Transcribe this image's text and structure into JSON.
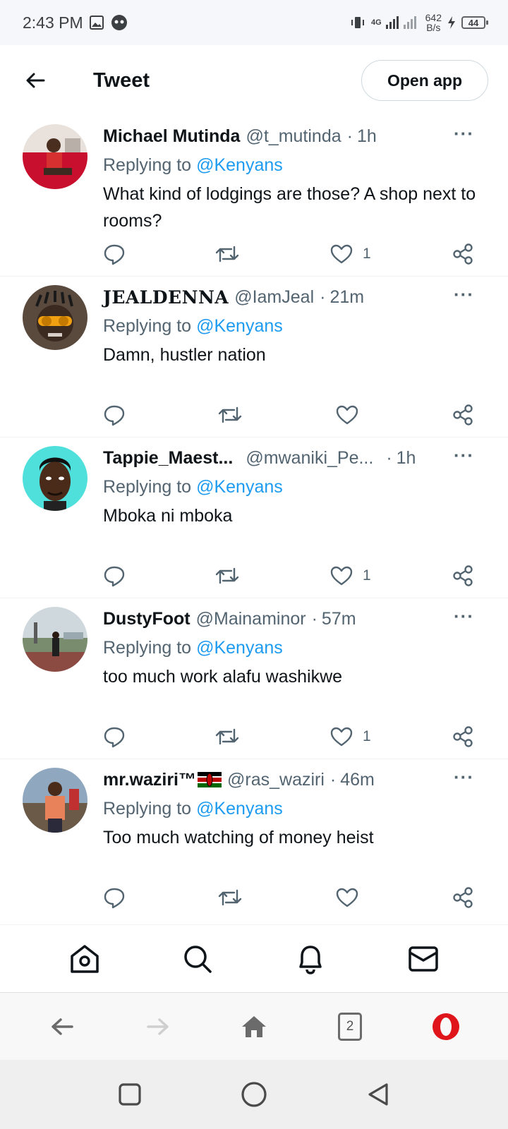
{
  "status_bar": {
    "time": "2:43 PM",
    "network": "4G",
    "speed_value": "642",
    "speed_unit": "B/s",
    "battery": "44"
  },
  "header": {
    "title": "Tweet",
    "open_app_label": "Open app"
  },
  "tweets": [
    {
      "name": "Michael Mutinda",
      "handle": "@t_mutinda",
      "separator": "·",
      "time": "1h",
      "replying_prefix": "Replying to",
      "replying_to": "@Kenyans",
      "text": "What kind of lodgings are those? A shop next to rooms?",
      "likes": "1",
      "more": "···"
    },
    {
      "name": "JEALDENNA",
      "handle": "@IamJeal",
      "separator": "·",
      "time": "21m",
      "replying_prefix": "Replying to",
      "replying_to": "@Kenyans",
      "text": "Damn, hustler nation",
      "likes": "",
      "more": "···"
    },
    {
      "name": "Tappie_Maest...",
      "handle": "@mwaniki_Pe...",
      "separator": "·",
      "time": "1h",
      "replying_prefix": "Replying to",
      "replying_to": "@Kenyans",
      "text": "Mboka ni mboka",
      "likes": "1",
      "more": "···"
    },
    {
      "name": "DustyFoot",
      "handle": "@Mainaminor",
      "separator": "·",
      "time": "57m",
      "replying_prefix": "Replying to",
      "replying_to": "@Kenyans",
      "text": "too much work alafu washikwe",
      "likes": "1",
      "more": "···"
    },
    {
      "name": "mr.waziri™",
      "handle": "@ras_waziri",
      "separator": "·",
      "time": "46m",
      "replying_prefix": "Replying to",
      "replying_to": "@Kenyans",
      "text": "Too much watching of money heist",
      "likes": "",
      "more": "···"
    }
  ],
  "tab_bar": {
    "items": [
      "home-icon",
      "search-icon",
      "bell-icon",
      "mail-icon"
    ]
  },
  "browser_bar": {
    "tab_count": "2"
  },
  "colors": {
    "accent": "#1d9bf0",
    "text": "#0f1419",
    "secondary": "#536471",
    "opera_red": "#e0151b"
  }
}
